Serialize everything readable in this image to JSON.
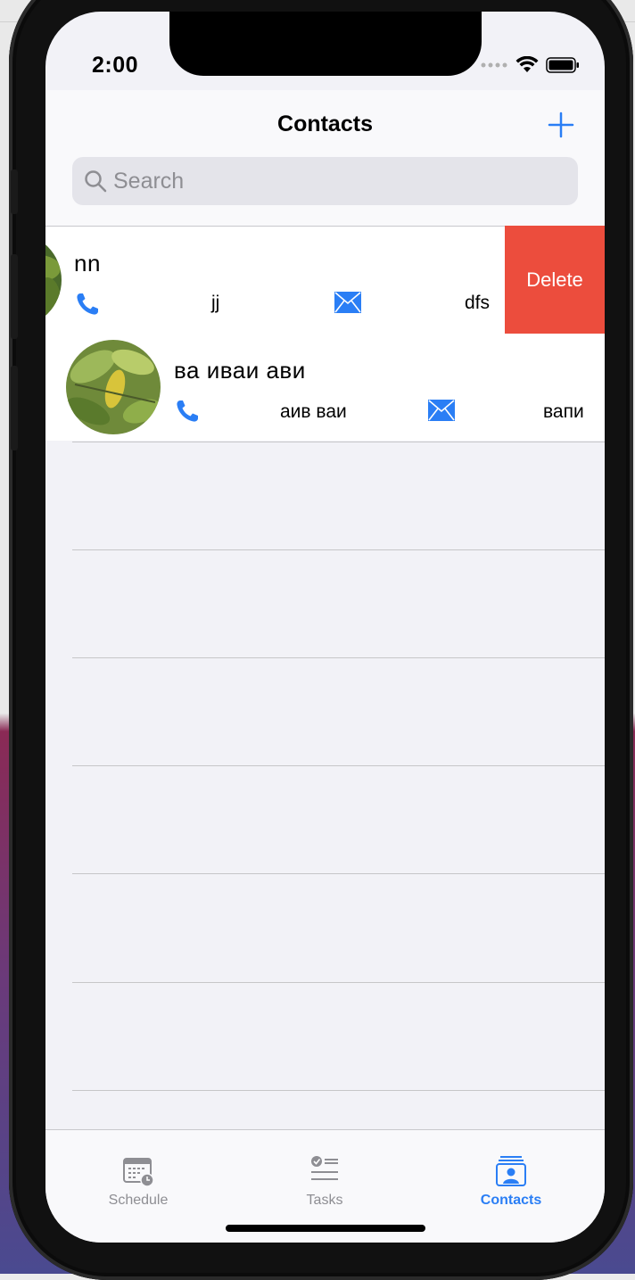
{
  "status": {
    "time": "2:00"
  },
  "nav": {
    "title": "Contacts"
  },
  "search": {
    "placeholder": "Search"
  },
  "contacts": [
    {
      "name": "nn",
      "phone": "jj",
      "email": "dfs",
      "delete_label": "Delete"
    },
    {
      "name": "ва иваи ави",
      "phone": "аив ваи",
      "email": "вапи"
    }
  ],
  "tabs": [
    {
      "label": "Schedule",
      "icon": "calendar-clock-icon",
      "active": false
    },
    {
      "label": "Tasks",
      "icon": "checklist-icon",
      "active": false
    },
    {
      "label": "Contacts",
      "icon": "contact-card-icon",
      "active": true
    }
  ],
  "colors": {
    "accent": "#2a7ef5",
    "delete": "#ec4d3d",
    "background": "#f2f2f7"
  }
}
